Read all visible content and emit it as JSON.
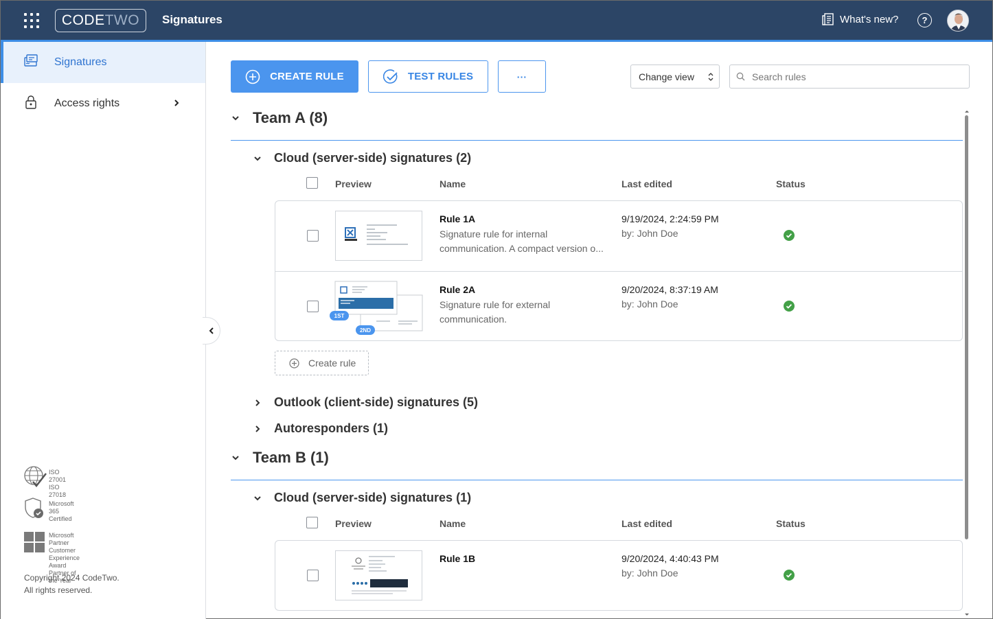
{
  "header": {
    "logo": {
      "code": "CODE",
      "two": "TWO"
    },
    "app_title": "Signatures",
    "whats_new": "What's new?",
    "help": "?"
  },
  "sidebar": {
    "items": [
      {
        "label": "Signatures",
        "icon": "signature-icon",
        "active": true
      },
      {
        "label": "Access rights",
        "icon": "lock-icon",
        "active": false
      }
    ],
    "badges": [
      {
        "text": "ISO 27001\nISO 27018",
        "icon": "iso-globe-icon"
      },
      {
        "text": "Microsoft 365\nCertified",
        "icon": "shield-check-icon"
      },
      {
        "text": "Microsoft Partner\nCustomer Experience Award\nPartner of the Year",
        "icon": "microsoft-logo-icon"
      }
    ],
    "copyright_line1": "Copyright 2024 CodeTwo.",
    "copyright_line2": "All rights reserved."
  },
  "toolbar": {
    "create_rule": "CREATE RULE",
    "test_rules": "TEST RULES",
    "more": "···",
    "change_view": "Change view",
    "search_placeholder": "Search rules"
  },
  "columns": {
    "preview": "Preview",
    "name": "Name",
    "last_edited": "Last edited",
    "status": "Status"
  },
  "teams": [
    {
      "title": "Team A (8)",
      "sections": [
        {
          "title": "Cloud (server-side) signatures (2)",
          "expanded": true,
          "rules": [
            {
              "name": "Rule 1A",
              "desc": "Signature rule for internal communication. A compact version o...",
              "date": "9/19/2024, 2:24:59 PM",
              "by": "by: John Doe",
              "status": "active"
            },
            {
              "name": "Rule 2A",
              "desc": "Signature rule for external communication.",
              "date": "9/20/2024, 8:37:19 AM",
              "by": "by: John Doe",
              "status": "active",
              "badges": [
                "1ST",
                "2ND"
              ]
            }
          ],
          "create_rule": "Create rule"
        },
        {
          "title": "Outlook (client-side) signatures (5)",
          "expanded": false
        },
        {
          "title": "Autoresponders (1)",
          "expanded": false
        }
      ]
    },
    {
      "title": "Team B (1)",
      "sections": [
        {
          "title": "Cloud (server-side) signatures (1)",
          "expanded": true,
          "rules": [
            {
              "name": "Rule 1B",
              "desc": "",
              "date": "9/20/2024, 4:40:43 PM",
              "by": "by: John Doe",
              "status": "active"
            }
          ]
        }
      ]
    }
  ],
  "colors": {
    "header_bg": "#2c4566",
    "accent": "#4b95ee",
    "status_ok": "#43a047"
  }
}
